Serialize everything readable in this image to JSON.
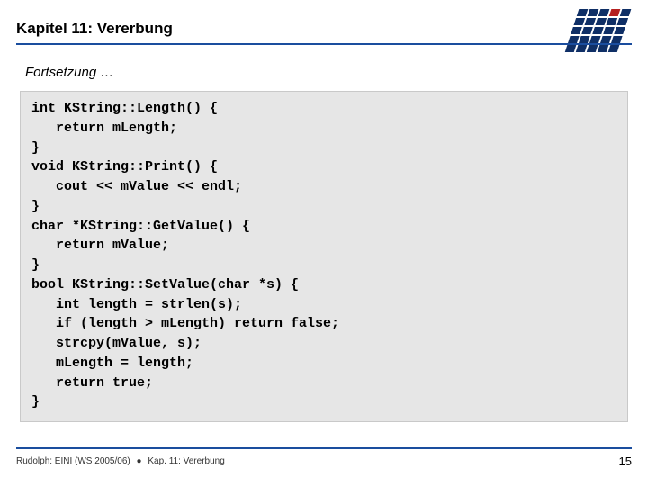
{
  "header": {
    "title": "Kapitel 11: Vererbung"
  },
  "subtitle": "Fortsetzung …",
  "code": "int KString::Length() {\n   return mLength;\n}\nvoid KString::Print() {\n   cout << mValue << endl;\n}\nchar *KString::GetValue() {\n   return mValue;\n}\nbool KString::SetValue(char *s) {\n   int length = strlen(s);\n   if (length > mLength) return false;\n   strcpy(mValue, s);\n   mLength = length;\n   return true;\n}",
  "footer": {
    "left_author": "Rudolph: EINI (WS 2005/06)",
    "bullet": "●",
    "left_chapter": "Kap. 11: Vererbung",
    "page": "15"
  }
}
